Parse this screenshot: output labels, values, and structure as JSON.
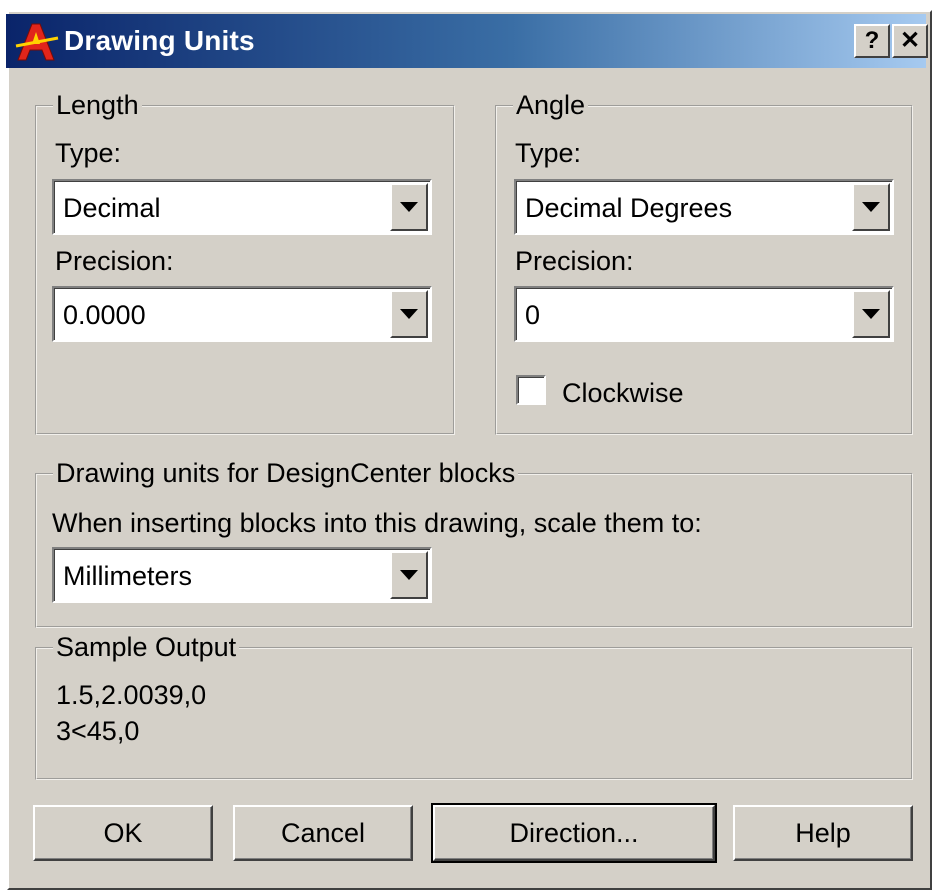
{
  "window": {
    "title": "Drawing Units",
    "help_glyph": "?",
    "close_glyph": "✕",
    "icon": "autocad-app-icon"
  },
  "length": {
    "group_label": "Length",
    "type_label": "Type:",
    "type_value": "Decimal",
    "precision_label": "Precision:",
    "precision_value": "0.0000"
  },
  "angle": {
    "group_label": "Angle",
    "type_label": "Type:",
    "type_value": "Decimal Degrees",
    "precision_label": "Precision:",
    "precision_value": "0",
    "clockwise_label": "Clockwise",
    "clockwise_checked": false
  },
  "designcenter": {
    "group_label": "Drawing units for DesignCenter blocks",
    "instruction": "When inserting blocks into this drawing, scale them to:",
    "units_value": "Millimeters"
  },
  "sample_output": {
    "group_label": "Sample Output",
    "line1": "1.5,2.0039,0",
    "line2": "3<45,0"
  },
  "buttons": {
    "ok": "OK",
    "cancel": "Cancel",
    "direction": "Direction...",
    "help": "Help"
  },
  "colors": {
    "dialog_face": "#d4d0c8",
    "title_start": "#0a246a",
    "title_end": "#a6caf0"
  }
}
